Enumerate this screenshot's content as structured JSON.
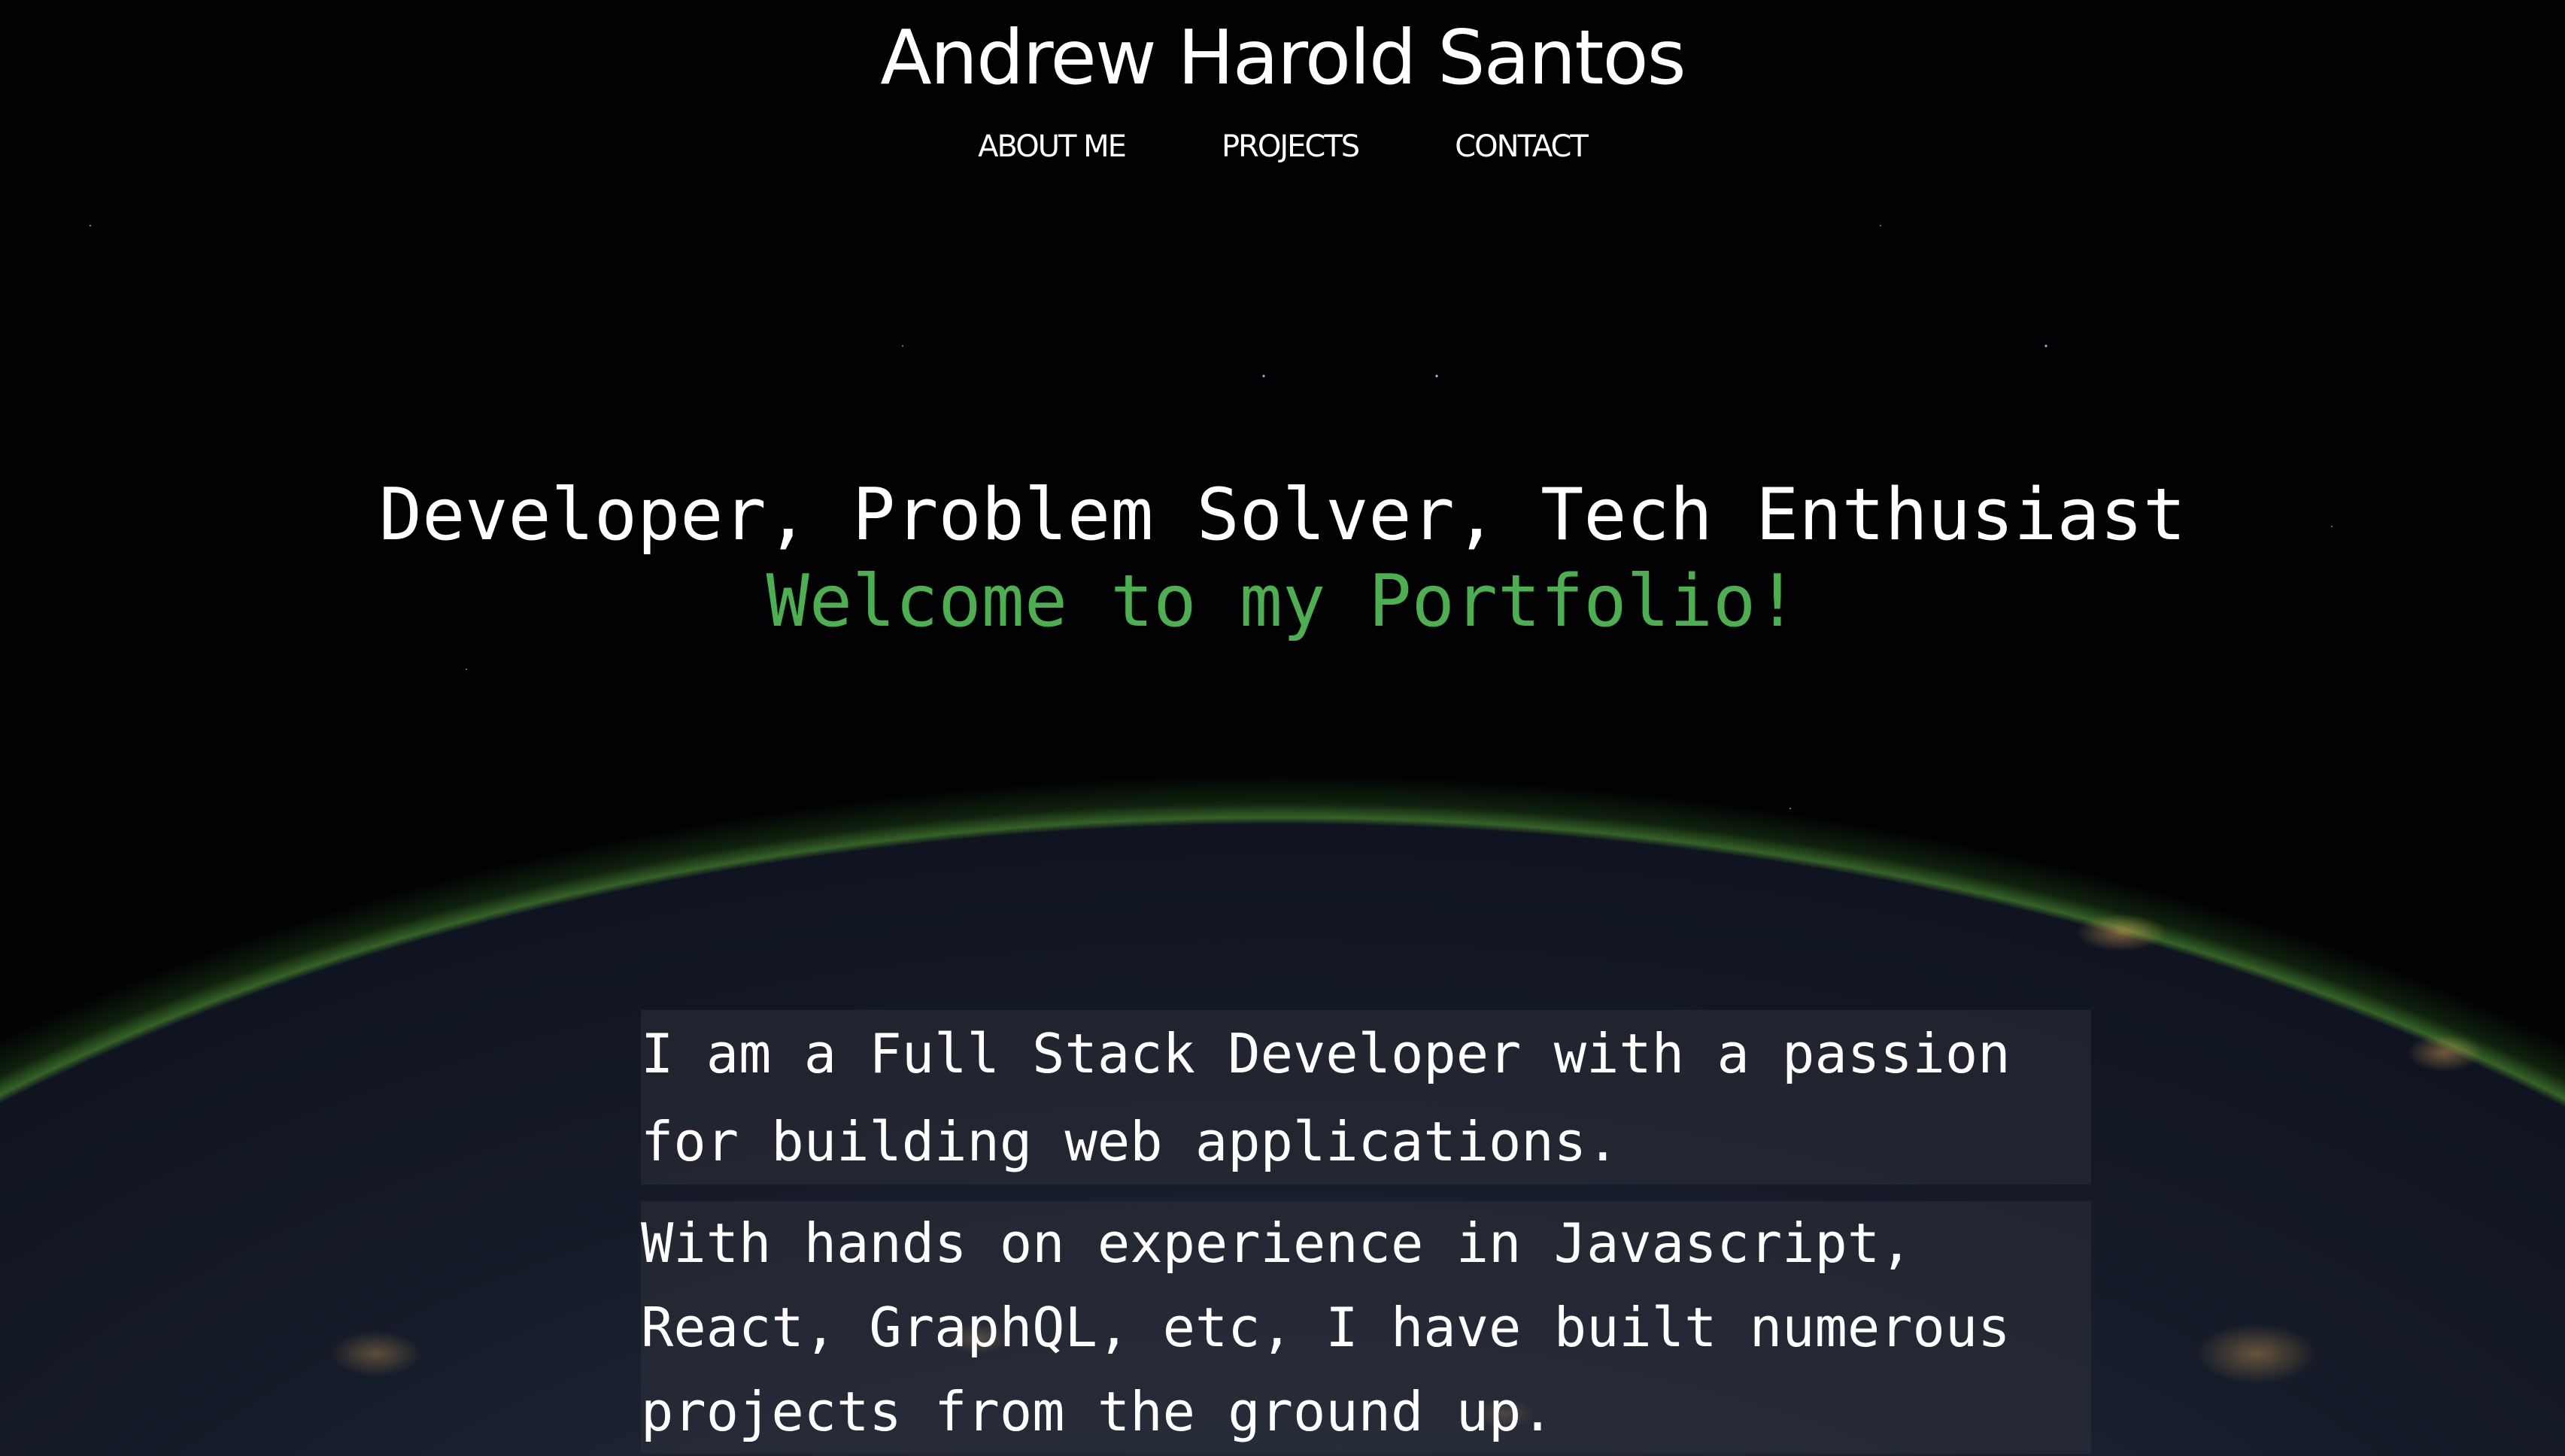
{
  "header": {
    "title": "Andrew Harold Santos",
    "nav": [
      "ABOUT ME",
      "PROJECTS",
      "CONTACT"
    ]
  },
  "hero": {
    "tagline": "Developer, Problem Solver, Tech Enthusiast",
    "welcome": "Welcome to my Portfolio!",
    "welcome_color": "#4caf50"
  },
  "about": {
    "paragraphs": [
      "I am a Full Stack Developer with a passion for building web applications.",
      "With hands on experience in Javascript, React, GraphQL, etc, I have built numerous projects from the ground up."
    ]
  }
}
